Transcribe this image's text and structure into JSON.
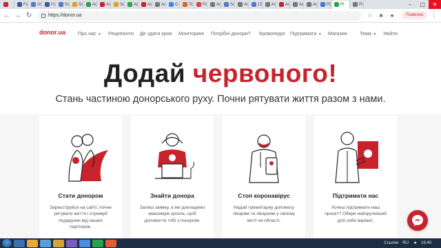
{
  "browser": {
    "tabs": [
      {
        "label": "",
        "color": "#c8232c"
      },
      {
        "label": "Fc",
        "color": "#3b5998"
      },
      {
        "label": "Sc",
        "color": "#4a7bd0"
      },
      {
        "label": "Fc",
        "color": "#3b5998"
      },
      {
        "label": "Sc",
        "color": "#4a7bd0"
      },
      {
        "label": "Sc",
        "color": "#e0a020"
      },
      {
        "label": "Ac",
        "color": "#2aa34a"
      },
      {
        "label": "Ac",
        "color": "#c8232c"
      },
      {
        "label": "Sc",
        "color": "#e0a020"
      },
      {
        "label": "Ac",
        "color": "#2aa34a"
      },
      {
        "label": "Ac",
        "color": "#c8232c"
      },
      {
        "label": "Ac",
        "color": "#777777"
      },
      {
        "label": "G pl",
        "color": "#4285f4"
      },
      {
        "label": "Tc",
        "color": "#e06020"
      },
      {
        "label": "Pc",
        "color": "#d44"
      },
      {
        "label": "Ac",
        "color": "#777777"
      },
      {
        "label": "Sc",
        "color": "#4a7bd0"
      },
      {
        "label": "Ac",
        "color": "#777777"
      },
      {
        "label": "15",
        "color": "#4a7bd0"
      },
      {
        "label": "Ac",
        "color": "#777777"
      },
      {
        "label": "Ac",
        "color": "#c8232c"
      },
      {
        "label": "Ac",
        "color": "#777777"
      },
      {
        "label": "Ac",
        "color": "#777777"
      },
      {
        "label": "P(",
        "color": "#4a7bd0"
      }
    ],
    "active_tab_label": "",
    "extra_tabs": [
      {
        "label": "Pi",
        "color": "#2aa34a"
      },
      {
        "label": "Pi",
        "color": "#777777"
      }
    ],
    "url": "https://donor.ua",
    "profile_button": "Помилка"
  },
  "site": {
    "logo": "donor.ua",
    "nav": [
      {
        "label": "Про нас",
        "caret": "▼"
      },
      {
        "label": "Реципієнти",
        "caret": ""
      },
      {
        "label": "Де здати кров",
        "caret": ""
      },
      {
        "label": "Моніторинг",
        "caret": ""
      },
      {
        "label": "Потрібні донори?",
        "caret": ""
      },
      {
        "label": "Кровопедія",
        "caret": ""
      },
      {
        "label": "Підтримати",
        "caret": "▼"
      },
      {
        "label": "Магазин",
        "caret": ""
      },
      {
        "label": "Тема",
        "caret": "▼"
      },
      {
        "label": "Увійти",
        "caret": ""
      }
    ],
    "accent": "#c8232c"
  },
  "hero": {
    "title_part1": "Додай ",
    "title_part2": "червоного!",
    "subtitle": "Стань частиною донорського руху. Почни рятувати життя разом з нами."
  },
  "cards": [
    {
      "title": "Стати донором",
      "text": "Зареєструйся на сайті, почни рятувати життя і отримуй подарунки від наших партнерів.",
      "icon": "donor-couple-icon"
    },
    {
      "title": "Знайти донора",
      "text": "Залиш заявку, а ми докладемо максимум зусиль, щоб допомогти тобі з пошуком.",
      "icon": "laptop-person-icon"
    },
    {
      "title": "Стоп коронавірус",
      "text": "Надай гуманітарну допомогу лікарям та лікарням у своєму місті чи області.",
      "icon": "doctor-mask-icon"
    },
    {
      "title": "Підтримати нас",
      "text": "Хочеш підтримати наш проєкт? Обери найзручніший для себе варіант.",
      "icon": "supporter-icon"
    }
  ],
  "taskbar": {
    "lang": "RU",
    "links": "Ссылки",
    "time": "16:49"
  }
}
